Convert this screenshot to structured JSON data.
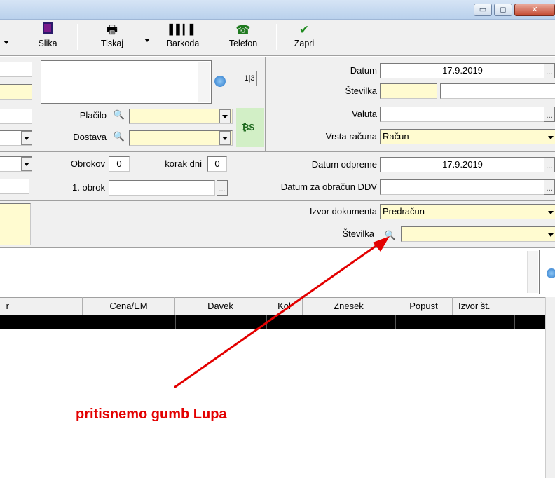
{
  "window": {
    "min_label": "▭",
    "max_label": "◻",
    "close_label": "✕"
  },
  "toolbar": {
    "slika": "Slika",
    "tiskaj": "Tiskaj",
    "barkoda": "Barkoda",
    "telefon": "Telefon",
    "zapri": "Zapri"
  },
  "form": {
    "datum_label": "Datum",
    "datum_value": "17.9.2019",
    "stevilka_label": "Številka",
    "placilo_label": "Plačilo",
    "dostava_label": "Dostava",
    "valuta_label": "Valuta",
    "vrsta_racuna_label": "Vrsta računa",
    "vrsta_racuna_value": "Račun",
    "obrokov_label": "Obrokov",
    "obrokov_value": "0",
    "korak_dni_label": "korak dni",
    "korak_dni_value": "0",
    "prvi_obrok_label": "1. obrok",
    "datum_odpreme_label": "Datum odpreme",
    "datum_odpreme_value": "17.9.2019",
    "datum_ddv_label": "Datum za obračun DDV",
    "izvor_dokumenta_label": "Izvor dokumenta",
    "izvor_dokumenta_value": "Predračun",
    "izvor_stevilka_label": "Številka",
    "calendar_icon_text": "1|3",
    "ellipsis": "..."
  },
  "grid": {
    "columns": [
      "r",
      "Cena/EM",
      "Davek",
      "Kol",
      "Znesek",
      "Popust",
      "Izvor št."
    ]
  },
  "annotation": {
    "text": "pritisnemo gumb Lupa",
    "color": "#e30000"
  },
  "colors": {
    "required_field": "#fffbd0",
    "toolbar_bg": "#f0f0f0"
  }
}
